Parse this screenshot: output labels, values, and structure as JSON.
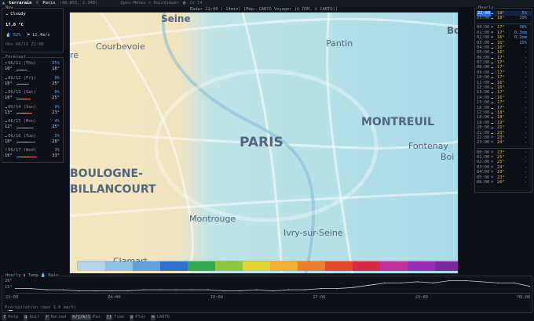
{
  "titlebar": {
    "app": "terrarain",
    "location": "Paris",
    "coords": "(48.853, 2.349)",
    "source": "Open-Meteo + RainViewer",
    "time": "22:14"
  },
  "now": {
    "title": "Now",
    "condition": "Cloudy",
    "temp": "17.8 °C",
    "humidity": "52%",
    "wind": "12.4m/s",
    "observed": "Obs 06/11 22:00"
  },
  "forecast": {
    "title": "Forecast",
    "days": [
      {
        "date": "06/11 (Thu)",
        "pop": "55%",
        "low": "10°",
        "high": "18°",
        "icon": "cloud-rain-icon"
      },
      {
        "date": "06/12 (Fri)",
        "pop": "0%",
        "low": "16°",
        "high": "25°",
        "icon": "cloud-icon"
      },
      {
        "date": "06/13 (Sat)",
        "pop": "0%",
        "low": "16°",
        "high": "25°",
        "icon": "cloud-icon"
      },
      {
        "date": "06/14 (Sun)",
        "pop": "0%",
        "low": "13°",
        "high": "23°",
        "icon": "cloud-icon"
      },
      {
        "date": "06/15 (Mon)",
        "pop": "4%",
        "low": "12°",
        "high": "25°",
        "icon": "cloud-icon"
      },
      {
        "date": "06/16 (Tue)",
        "pop": "5%",
        "low": "18°",
        "high": "28°",
        "icon": "cloud-icon"
      },
      {
        "date": "06/17 (Wed)",
        "pop": "3%",
        "low": "16°",
        "high": "33°",
        "icon": "sun-icon"
      }
    ]
  },
  "map": {
    "info": "Radar  22:00 (-14min)  [Map: CARTO Voyager (© OSM, © CARTO)]",
    "labels": [
      {
        "text": "Seine",
        "cls": "l-seine"
      },
      {
        "text": "Courbevoie",
        "cls": "l-courbevoie"
      },
      {
        "text": "Pantin",
        "cls": "l-pantin"
      },
      {
        "text": "Bo",
        "cls": "l-bo"
      },
      {
        "text": "re",
        "cls": "l-re"
      },
      {
        "text": "PARIS",
        "cls": "l-paris"
      },
      {
        "text": "MONTREUIL",
        "cls": "l-montreuil"
      },
      {
        "text": "Fontenay",
        "cls": "l-fontenay"
      },
      {
        "text": "Boi",
        "cls": "l-boi"
      },
      {
        "text": "BOULOGNE-",
        "cls": "l-boulogne"
      },
      {
        "text": "BILLANCOURT",
        "cls": "l-billancourt"
      },
      {
        "text": "Montrouge",
        "cls": "l-montrouge"
      },
      {
        "text": "Ivry-sur-Seine",
        "cls": "l-ivry"
      },
      {
        "text": "Clamart",
        "cls": "l-clamart"
      }
    ],
    "legend_colors": [
      "#b7d5ea",
      "#8fc1e4",
      "#5fa3da",
      "#2f6fcf",
      "#35a852",
      "#8dc63f",
      "#e6d534",
      "#f2b233",
      "#ec7d2c",
      "#e44a2c",
      "#d82a45",
      "#c02f9b",
      "#9a2db8",
      "#7a2a9c"
    ]
  },
  "hourly": {
    "title": "Hourly",
    "rows": [
      {
        "t": "22:00",
        "i": "cloud-icon",
        "temp": "18°",
        "p": "5%",
        "sel": true
      },
      {
        "t": "23:00",
        "i": "cloud-icon",
        "temp": "18°",
        "p": "10%"
      },
      {
        "t": "",
        "i": "",
        "temp": "",
        "p": ""
      },
      {
        "t": "00:00",
        "i": "cloud-rain-icon",
        "temp": "17°",
        "p": "30%"
      },
      {
        "t": "01:00",
        "i": "cloud-rain-icon",
        "temp": "17°",
        "p": "0.3mm"
      },
      {
        "t": "02:00",
        "i": "cloud-rain-icon",
        "temp": "16°",
        "p": "0.2mm"
      },
      {
        "t": "03:00",
        "i": "cloud-icon",
        "temp": "16°",
        "p": "15%"
      },
      {
        "t": "04:00",
        "i": "cloud-icon",
        "temp": "16°",
        "p": "-"
      },
      {
        "t": "05:00",
        "i": "cloud-icon",
        "temp": "16°",
        "p": "-"
      },
      {
        "t": "06:00",
        "i": "cloud-icon",
        "temp": "17°",
        "p": "-"
      },
      {
        "t": "07:00",
        "i": "cloud-icon",
        "temp": "17°",
        "p": "-"
      },
      {
        "t": "08:00",
        "i": "cloud-icon",
        "temp": "17°",
        "p": "-"
      },
      {
        "t": "09:00",
        "i": "cloud-icon",
        "temp": "17°",
        "p": "-"
      },
      {
        "t": "10:00",
        "i": "cloud-icon",
        "temp": "17°",
        "p": "-"
      },
      {
        "t": "11:00",
        "i": "cloud-icon",
        "temp": "16°",
        "p": "-"
      },
      {
        "t": "12:00",
        "i": "cloud-icon",
        "temp": "16°",
        "p": "-"
      },
      {
        "t": "13:00",
        "i": "cloud-icon",
        "temp": "17°",
        "p": "-"
      },
      {
        "t": "14:00",
        "i": "cloud-icon",
        "temp": "16°",
        "p": "-"
      },
      {
        "t": "15:00",
        "i": "cloud-icon",
        "temp": "17°",
        "p": "-"
      },
      {
        "t": "16:00",
        "i": "cloud-icon",
        "temp": "17°",
        "p": "-"
      },
      {
        "t": "17:00",
        "i": "cloud-icon",
        "temp": "18°",
        "p": "-"
      },
      {
        "t": "18:00",
        "i": "cloud-icon",
        "temp": "18°",
        "p": "-"
      },
      {
        "t": "19:00",
        "i": "cloud-icon",
        "temp": "19°",
        "p": "-"
      },
      {
        "t": "20:00",
        "i": "cloud-icon",
        "temp": "21°",
        "p": "-"
      },
      {
        "t": "21:00",
        "i": "cloud-icon",
        "temp": "23°",
        "p": "-"
      },
      {
        "t": "22:00",
        "i": "sun-icon",
        "temp": "23°",
        "p": "-"
      },
      {
        "t": "23:00",
        "i": "sun-icon",
        "temp": "24°",
        "p": "-"
      },
      {
        "t": "",
        "i": "",
        "temp": "",
        "p": ""
      },
      {
        "t": "00:00",
        "i": "sun-icon",
        "temp": "23°",
        "p": "-"
      },
      {
        "t": "01:00",
        "i": "sun-icon",
        "temp": "25°",
        "p": "-"
      },
      {
        "t": "02:00",
        "i": "sun-icon",
        "temp": "25°",
        "p": "-"
      },
      {
        "t": "03:00",
        "i": "sun-icon",
        "temp": "24°",
        "p": "-"
      },
      {
        "t": "04:00",
        "i": "sun-icon",
        "temp": "23°",
        "p": "-"
      },
      {
        "t": "05:00",
        "i": "sun-icon",
        "temp": "23°",
        "p": "-"
      },
      {
        "t": "06:00",
        "i": "sun-icon",
        "temp": "20°",
        "p": "-"
      }
    ]
  },
  "chart": {
    "title": "Hourly",
    "temp_label": "Temp",
    "rain_label": "Rain",
    "ymax": "26°",
    "ymin": "15°",
    "xticks": [
      "22:00",
      "04:00",
      "10:00",
      "17:00",
      "23:00",
      "06:00"
    ],
    "precip_label": "Precipitation (max 1.0 mm/h)"
  },
  "chart_data": {
    "type": "line",
    "title": "",
    "xlabel": "",
    "ylabel": "",
    "x": [
      "22:00",
      "23:00",
      "00:00",
      "01:00",
      "02:00",
      "03:00",
      "04:00",
      "05:00",
      "06:00",
      "07:00",
      "08:00",
      "09:00",
      "10:00",
      "11:00",
      "12:00",
      "13:00",
      "14:00",
      "15:00",
      "16:00",
      "17:00",
      "18:00",
      "19:00",
      "20:00",
      "21:00",
      "22:00",
      "23:00",
      "00:00",
      "01:00",
      "02:00",
      "03:00",
      "04:00",
      "05:00",
      "06:00"
    ],
    "series": [
      {
        "values": [
          18,
          18,
          17,
          17,
          16,
          16,
          16,
          16,
          17,
          17,
          17,
          17,
          17,
          16,
          16,
          17,
          16,
          17,
          17,
          18,
          18,
          19,
          21,
          23,
          23,
          24,
          23,
          25,
          25,
          24,
          23,
          23,
          20
        ]
      }
    ],
    "ylim": [
      15,
      26
    ]
  },
  "footer": {
    "keys": [
      {
        "k": "?",
        "label": "Help"
      },
      {
        "k": "q",
        "label": "Quit"
      },
      {
        "k": "r",
        "label": "Reload"
      },
      {
        "k": "h/j/k/l",
        "label": "Pan"
      },
      {
        "k": "[]",
        "label": "Time"
      },
      {
        "k": "p",
        "label": "Play"
      },
      {
        "k": "m",
        "label": "CARTO"
      }
    ]
  }
}
